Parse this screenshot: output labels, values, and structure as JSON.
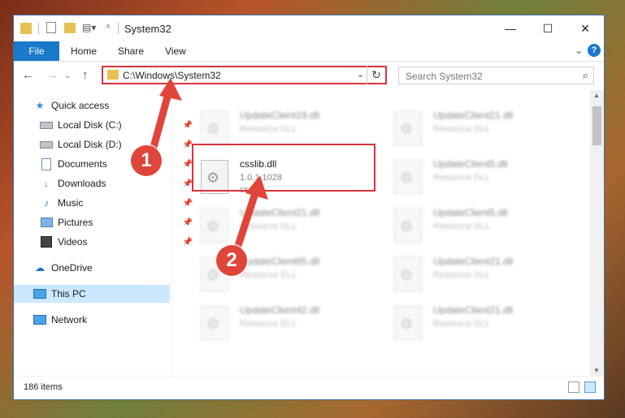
{
  "window": {
    "title": "System32"
  },
  "ribbon": {
    "file": "File",
    "home": "Home",
    "share": "Share",
    "view": "View",
    "help": "?"
  },
  "address": {
    "path": "C:\\Windows\\System32"
  },
  "search": {
    "placeholder": "Search System32"
  },
  "sidebar": {
    "items": [
      {
        "label": "Quick access"
      },
      {
        "label": "Local Disk (C:)"
      },
      {
        "label": "Local Disk (D:)"
      },
      {
        "label": "Documents"
      },
      {
        "label": "Downloads"
      },
      {
        "label": "Music"
      },
      {
        "label": "Pictures"
      },
      {
        "label": "Videos"
      },
      {
        "label": "OneDrive"
      },
      {
        "label": "This PC"
      },
      {
        "label": "Network"
      }
    ]
  },
  "files": {
    "highlighted": {
      "name": "csslib.dll",
      "version": "1.0.1.1028",
      "desc": "csslib"
    },
    "background": [
      {
        "name": "UpdateClient19.dll",
        "desc": "Resource DLL"
      },
      {
        "name": "UpdateClient21.dll",
        "desc": "Resource DLL"
      },
      {
        "name": "UpdateClient5.dll",
        "desc": "Resource DLL"
      },
      {
        "name": "UpdateClient21.dll",
        "desc": "Resource DLL"
      },
      {
        "name": "UpdateClient5.dll",
        "desc": "Resource DLL"
      },
      {
        "name": "UpdateClient65.dll",
        "desc": "Resource DLL"
      },
      {
        "name": "UpdateClient21.dll",
        "desc": "Resource DLL"
      },
      {
        "name": "UpdateClient42.dll",
        "desc": "Resource DLL"
      },
      {
        "name": "UpdateClient21.dll",
        "desc": "Resource DLL"
      }
    ]
  },
  "status": {
    "items": "186 items"
  },
  "annotations": {
    "one": "1",
    "two": "2"
  },
  "colors": {
    "accent": "#1979ca",
    "highlight": "#d9333c",
    "selected": "#cce8ff"
  }
}
